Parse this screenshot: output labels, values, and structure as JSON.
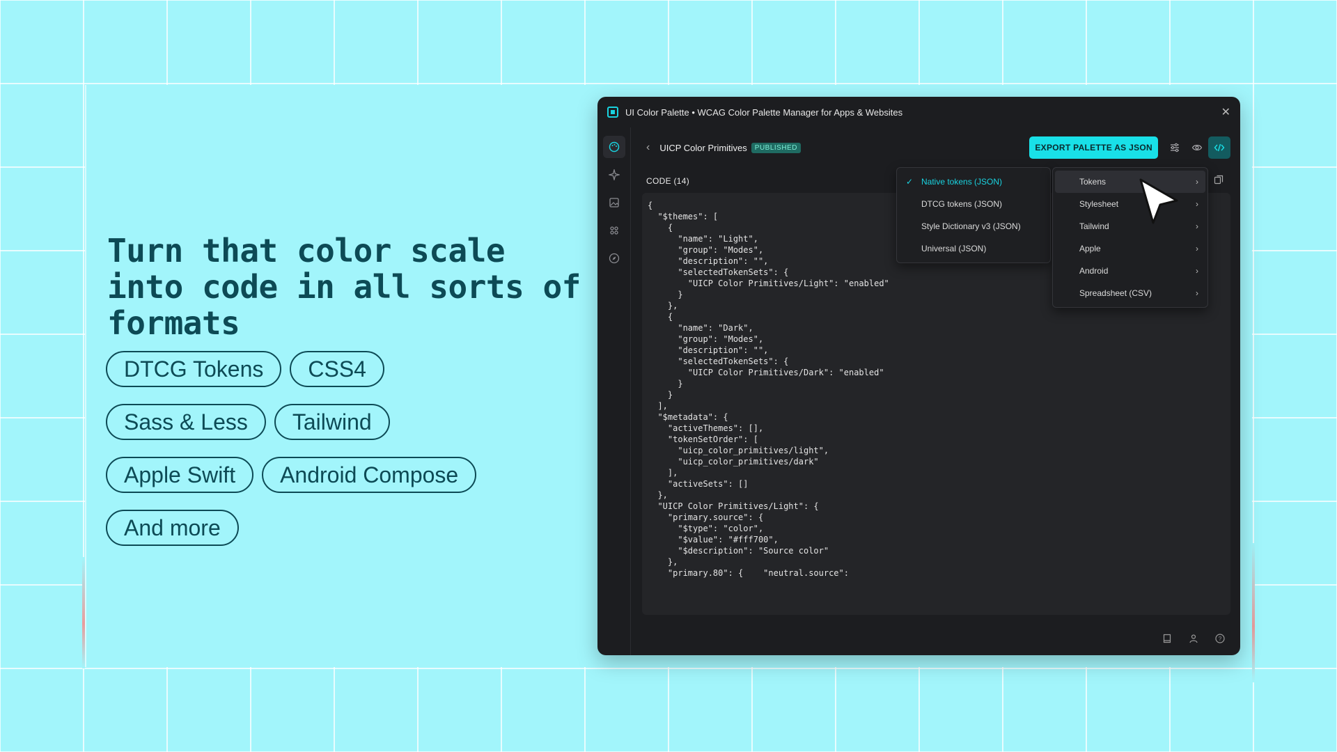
{
  "marketing": {
    "headline": "Turn that color scale into code in all sorts of formats",
    "pills": [
      "DTCG Tokens",
      "CSS4",
      "Sass & Less",
      "Tailwind",
      "Apple Swift",
      "Android Compose",
      "And more"
    ]
  },
  "window": {
    "title": "UI Color Palette • WCAG Color Palette Manager for Apps & Websites",
    "sidebar_icons": [
      "palette-icon",
      "sparkle-icon",
      "image-icon",
      "apps-grid-icon",
      "compass-icon"
    ],
    "palette_name": "UICP Color Primitives",
    "status_badge": "PUBLISHED",
    "export_button": "EXPORT PALETTE AS JSON",
    "code_label": "CODE (14)",
    "code_lines": [
      "{",
      "  \"$themes\": [",
      "    {",
      "      \"name\": \"Light\",",
      "      \"group\": \"Modes\",",
      "      \"description\": \"\",",
      "      \"selectedTokenSets\": {",
      "        \"UICP Color Primitives/Light\": \"enabled\"",
      "      }",
      "    },",
      "    {",
      "      \"name\": \"Dark\",",
      "      \"group\": \"Modes\",",
      "      \"description\": \"\",",
      "      \"selectedTokenSets\": {",
      "        \"UICP Color Primitives/Dark\": \"enabled\"",
      "      }",
      "    }",
      "  ],",
      "  \"$metadata\": {",
      "    \"activeThemes\": [],",
      "    \"tokenSetOrder\": [",
      "      \"uicp_color_primitives/light\",",
      "      \"uicp_color_primitives/dark\"",
      "    ],",
      "    \"activeSets\": []",
      "  },",
      "  \"UICP Color Primitives/Light\": {",
      "    \"primary.source\": {",
      "      \"$type\": \"color\",",
      "      \"$value\": \"#fff700\",",
      "      \"$description\": \"Source color\"",
      "    },",
      "    \"primary.80\": {    \"neutral.source\":"
    ]
  },
  "format_submenu": {
    "selected": "Native tokens (JSON)",
    "items": [
      "Native tokens (JSON)",
      "DTCG tokens (JSON)",
      "Style Dictionary v3 (JSON)",
      "Universal (JSON)"
    ]
  },
  "format_menu": {
    "highlighted": "Tokens",
    "items": [
      "Tokens",
      "Stylesheet",
      "Tailwind",
      "Apple",
      "Android",
      "Spreadsheet (CSV)"
    ]
  },
  "colors": {
    "background": "#a2f5fb",
    "accent": "#19e0e8",
    "text_dark": "#0d4a55",
    "window_bg": "#1c1d20"
  }
}
